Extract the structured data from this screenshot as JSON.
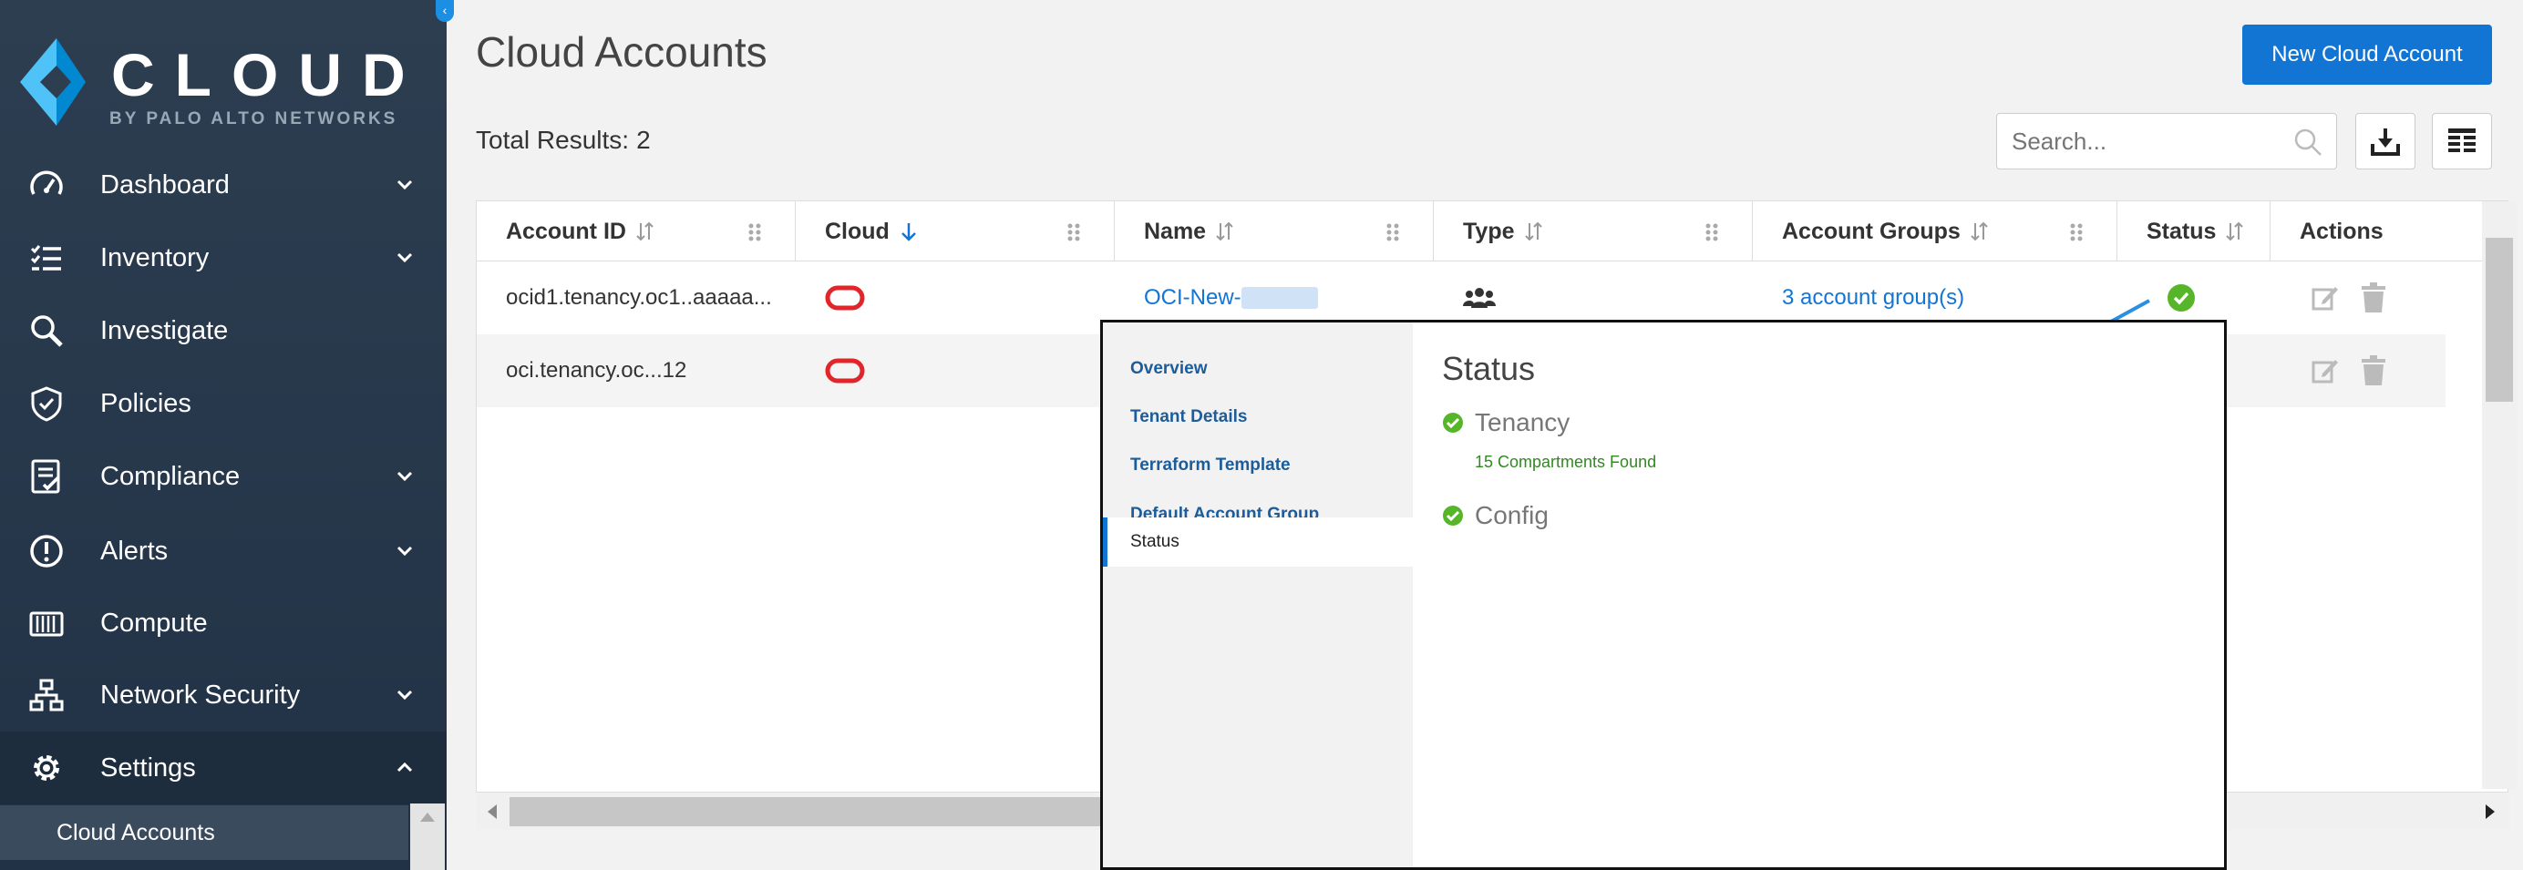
{
  "sidebar": {
    "logo_word": "CLOUD",
    "logo_sub": "BY PALO ALTO NETWORKS",
    "items": [
      {
        "label": "Dashboard",
        "icon": "speedometer-icon",
        "chevron": "down"
      },
      {
        "label": "Inventory",
        "icon": "list-check-icon",
        "chevron": "down"
      },
      {
        "label": "Investigate",
        "icon": "magnifier-icon",
        "chevron": ""
      },
      {
        "label": "Policies",
        "icon": "shield-check-icon",
        "chevron": ""
      },
      {
        "label": "Compliance",
        "icon": "checklist-icon",
        "chevron": "down"
      },
      {
        "label": "Alerts",
        "icon": "exclamation-circle-icon",
        "chevron": "down"
      },
      {
        "label": "Compute",
        "icon": "container-icon",
        "chevron": ""
      },
      {
        "label": "Network Security",
        "icon": "network-icon",
        "chevron": "down"
      },
      {
        "label": "Settings",
        "icon": "gear-icon",
        "chevron": "up"
      }
    ],
    "active_subitem": "Cloud Accounts"
  },
  "header": {
    "title": "Cloud Accounts",
    "new_button": "New Cloud Account",
    "total_label": "Total Results:",
    "total_value": "2",
    "search_placeholder": "Search..."
  },
  "table": {
    "columns": [
      "Account ID",
      "Cloud",
      "Name",
      "Type",
      "Account Groups",
      "Status",
      "Actions"
    ],
    "rows": [
      {
        "account_id": "ocid1.tenancy.oc1..aaaaa...",
        "cloud": "oracle-icon",
        "name": "OCI-New-",
        "type": "group-icon",
        "account_groups": "3 account group(s)",
        "status": "ok"
      },
      {
        "account_id": "oci.tenancy.oc...12",
        "cloud": "oracle-icon",
        "name": "",
        "type": "",
        "account_groups": "",
        "status": ""
      }
    ]
  },
  "popup": {
    "menu": [
      "Overview",
      "Tenant Details",
      "Terraform Template",
      "Default Account Group",
      "Status"
    ],
    "active": "Status",
    "title": "Status",
    "checks": [
      {
        "label": "Tenancy",
        "detail": "15 Compartments Found"
      },
      {
        "label": "Config",
        "detail": ""
      }
    ]
  },
  "colors": {
    "sidebar": "#2d3e51",
    "accent": "#1275d3",
    "oracle_red": "#e0262a",
    "success": "#57b52a"
  }
}
